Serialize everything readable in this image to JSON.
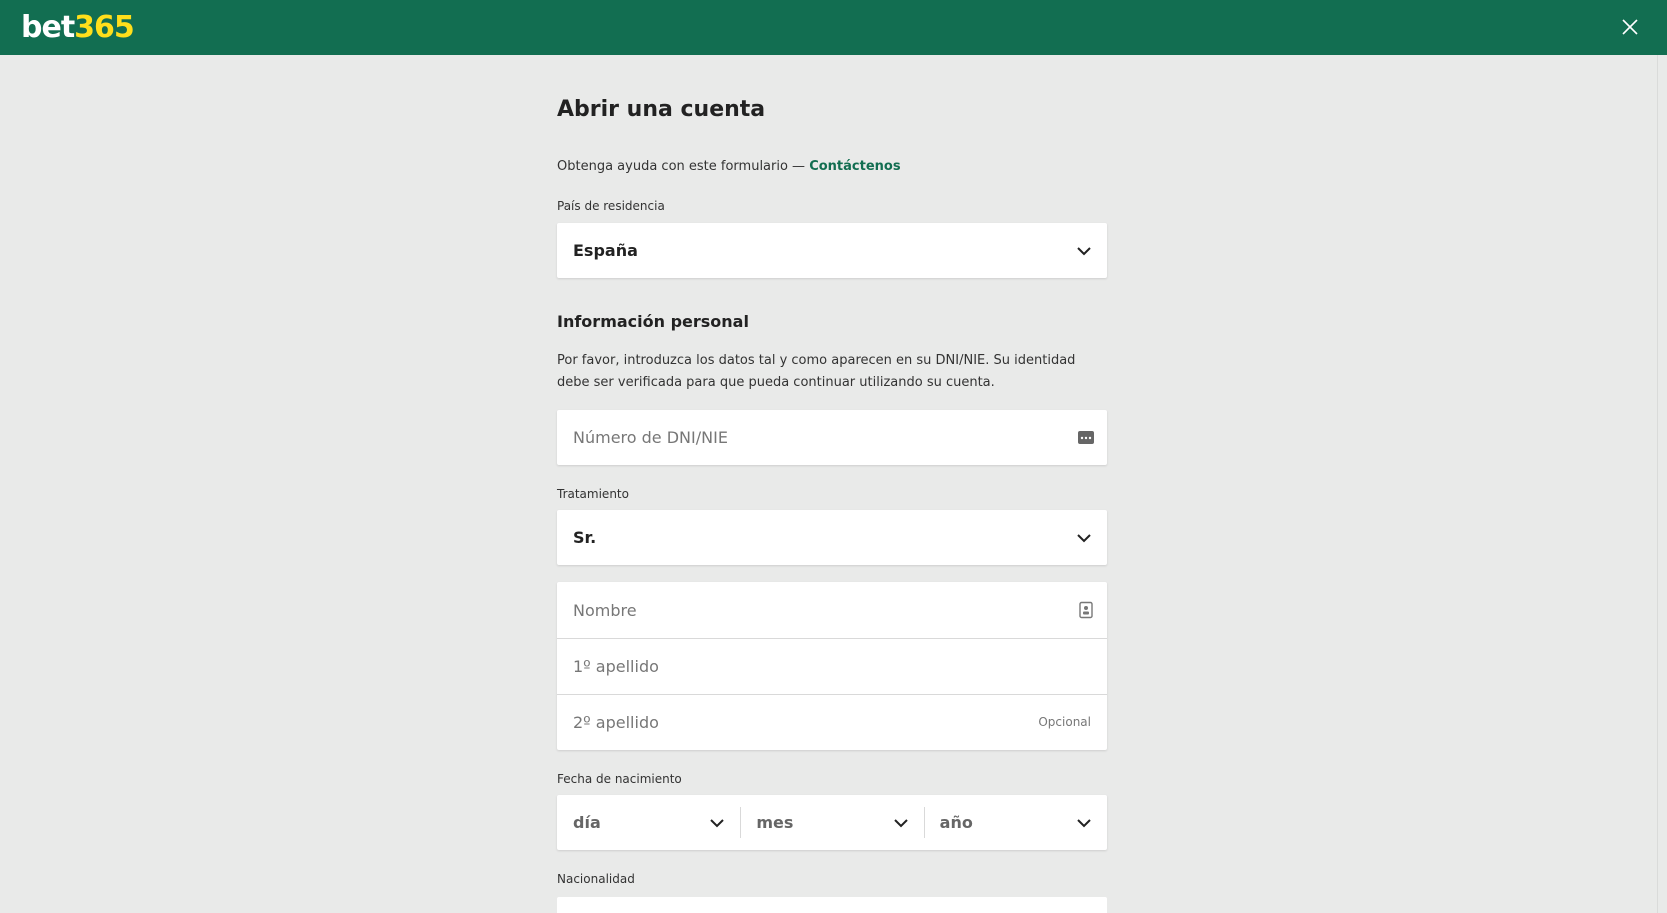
{
  "header": {
    "logo_bet": "bet",
    "logo_num": "365",
    "bg_color": "#126e51",
    "logo_accent": "#ffdf1b"
  },
  "form": {
    "title": "Abrir una cuenta",
    "help_text": "Obtenga ayuda con este formulario — ",
    "help_link": "Contáctenos",
    "country": {
      "label": "País de residencia",
      "value": "España"
    },
    "personal": {
      "title": "Información personal",
      "description": "Por favor, introduzca los datos tal y como aparecen en su DNI/NIE. Su identidad debe ser verificada para que pueda continuar utilizando su cuenta."
    },
    "dni": {
      "placeholder": "Número de DNI/NIE"
    },
    "title_field": {
      "label": "Tratamiento",
      "value": "Sr."
    },
    "name": {
      "placeholder": "Nombre"
    },
    "surname1": {
      "placeholder": "1º apellido"
    },
    "surname2": {
      "placeholder": "2º apellido",
      "optional": "Opcional"
    },
    "dob": {
      "label": "Fecha de nacimiento",
      "day": "día",
      "month": "mes",
      "year": "año"
    },
    "nationality": {
      "label": "Nacionalidad"
    }
  }
}
